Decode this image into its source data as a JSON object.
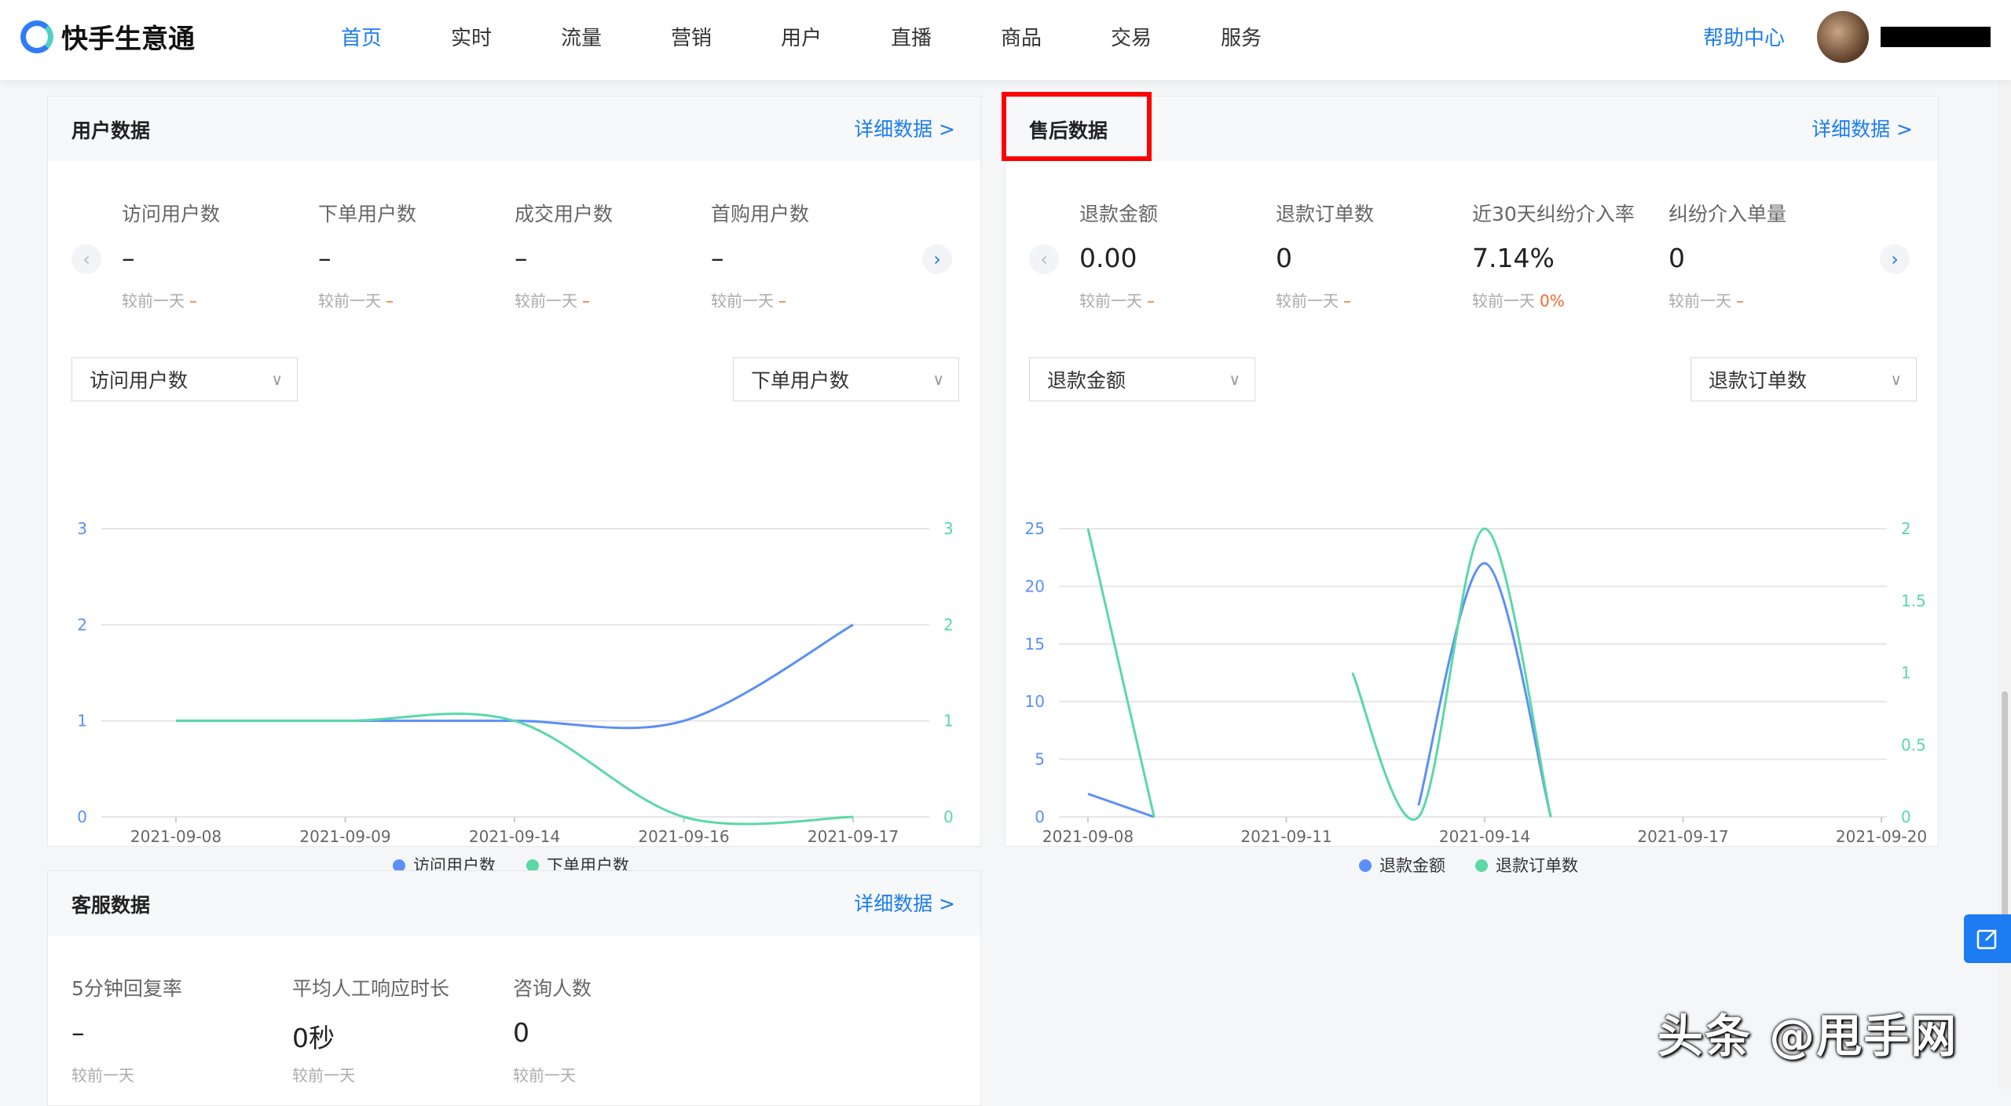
{
  "brand": {
    "name": "快手生意通"
  },
  "nav": {
    "items": [
      "首页",
      "实时",
      "流量",
      "营销",
      "用户",
      "直播",
      "商品",
      "交易",
      "服务"
    ],
    "active_index": 0
  },
  "header": {
    "help": "帮助中心"
  },
  "user_card": {
    "title": "用户数据",
    "link": "详细数据 >",
    "cmp_label": "较前一天",
    "metrics": [
      {
        "label": "访问用户数",
        "value": "–",
        "delta": "–"
      },
      {
        "label": "下单用户数",
        "value": "–",
        "delta": "–"
      },
      {
        "label": "成交用户数",
        "value": "–",
        "delta": "–"
      },
      {
        "label": "首购用户数",
        "value": "–",
        "delta": "–"
      }
    ],
    "select_left": "访问用户数",
    "select_right": "下单用户数"
  },
  "after_sales_card": {
    "title": "售后数据",
    "link": "详细数据 >",
    "cmp_label": "较前一天",
    "metrics": [
      {
        "label": "退款金额",
        "value": "0.00",
        "delta": "–"
      },
      {
        "label": "退款订单数",
        "value": "0",
        "delta": "–"
      },
      {
        "label": "近30天纠纷介入率",
        "value": "7.14%",
        "delta": "0%"
      },
      {
        "label": "纠纷介入单量",
        "value": "0",
        "delta": "–"
      }
    ],
    "select_left": "退款金额",
    "select_right": "退款订单数"
  },
  "service_card": {
    "title": "客服数据",
    "link": "详细数据 >",
    "cmp_label": "较前一天",
    "metrics": [
      {
        "label": "5分钟回复率",
        "value": "–"
      },
      {
        "label": "平均人工响应时长",
        "value": "0秒"
      },
      {
        "label": "咨询人数",
        "value": "0"
      }
    ]
  },
  "watermark": "头条 @甩手网",
  "colors": {
    "accent": "#1d7cf2",
    "series_blue": "#5b8ff9",
    "series_green": "#5ad8a6",
    "delta": "#f06a2a"
  },
  "chart_data": [
    {
      "type": "line",
      "categories": [
        "2021-09-08",
        "2021-09-09",
        "2021-09-14",
        "2021-09-16",
        "2021-09-17"
      ],
      "series": [
        {
          "name": "访问用户数",
          "axis": "left",
          "values": [
            1,
            1,
            1,
            1,
            2
          ]
        },
        {
          "name": "下单用户数",
          "axis": "right",
          "values": [
            1,
            1,
            1,
            0,
            0
          ]
        }
      ],
      "left_ticks": [
        "0",
        "1",
        "2",
        "3"
      ],
      "right_ticks": [
        "0",
        "1",
        "2",
        "3"
      ],
      "ylim_left": [
        0,
        3
      ],
      "ylim_right": [
        0,
        3
      ],
      "grid": true,
      "legend": "bottom"
    },
    {
      "type": "line",
      "x_ticks": [
        "2021-09-08",
        "2021-09-11",
        "2021-09-14",
        "2021-09-17",
        "2021-09-20"
      ],
      "series": [
        {
          "name": "退款金额",
          "axis": "left",
          "segments": [
            [
              [
                "2021-09-08",
                2
              ],
              [
                "2021-09-09",
                0
              ]
            ],
            [
              [
                "2021-09-13",
                1
              ],
              [
                "2021-09-14",
                22
              ],
              [
                "2021-09-15",
                0
              ]
            ]
          ]
        },
        {
          "name": "退款订单数",
          "axis": "right",
          "segments": [
            [
              [
                "2021-09-08",
                2
              ],
              [
                "2021-09-09",
                0
              ]
            ],
            [
              [
                "2021-09-12",
                1
              ],
              [
                "2021-09-13",
                0
              ],
              [
                "2021-09-14",
                2
              ],
              [
                "2021-09-15",
                0
              ]
            ]
          ]
        }
      ],
      "left_ticks": [
        "0",
        "5",
        "10",
        "15",
        "20",
        "25"
      ],
      "right_ticks": [
        "0",
        "0.5",
        "1",
        "1.5",
        "2"
      ],
      "ylim_left": [
        0,
        25
      ],
      "ylim_right": [
        0,
        2
      ],
      "grid": true,
      "legend": "bottom"
    }
  ]
}
